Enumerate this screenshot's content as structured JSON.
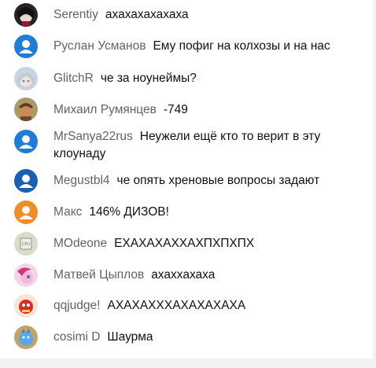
{
  "messages": [
    {
      "author": "Serentiy",
      "text": "ахахахахахаха",
      "avatar": "dark-anime-avatar-icon"
    },
    {
      "author": "Руслан Усманов",
      "text": "Ему пофиг на колхозы и на нас",
      "avatar": "default-user-avatar-icon"
    },
    {
      "author": "GlitchR",
      "text": "че за ноунеймы?",
      "avatar": "anime-girl-avatar-icon"
    },
    {
      "author": "Михаил Румянцев",
      "text": "-749",
      "avatar": "character-avatar-icon"
    },
    {
      "author": "MrSanya22rus",
      "text": "Неужели ещё кто то верит в эту клоунаду",
      "avatar": "default-user-avatar-icon"
    },
    {
      "author": "Megustbl4",
      "text": "че опять хреновые вопросы задают",
      "avatar": "default-user-avatar-icon"
    },
    {
      "author": "Макс",
      "text": "146% ДИЗОВ!",
      "avatar": "default-user-avatar-icon"
    },
    {
      "author": "MOdeone",
      "text": "ЕХАХАХАХХАХПХПХПХ",
      "avatar": "cpu-chip-avatar-icon"
    },
    {
      "author": "Матвей Цыплов",
      "text": "ахаххахаха",
      "avatar": "pony-avatar-icon"
    },
    {
      "author": "qqjudge!",
      "text": "АХАХАХХХАХАХАХАХА",
      "avatar": "red-character-avatar-icon"
    },
    {
      "author": "cosimi D",
      "text": "Шаурма",
      "avatar": "blue-creature-avatar-icon"
    }
  ],
  "colors": {
    "default_avatar_blue": "#1f7dd6",
    "megustbl4_avatar": "#1a5fb4",
    "maks_avatar": "#f28c28",
    "author_gray": "#5f6368"
  }
}
